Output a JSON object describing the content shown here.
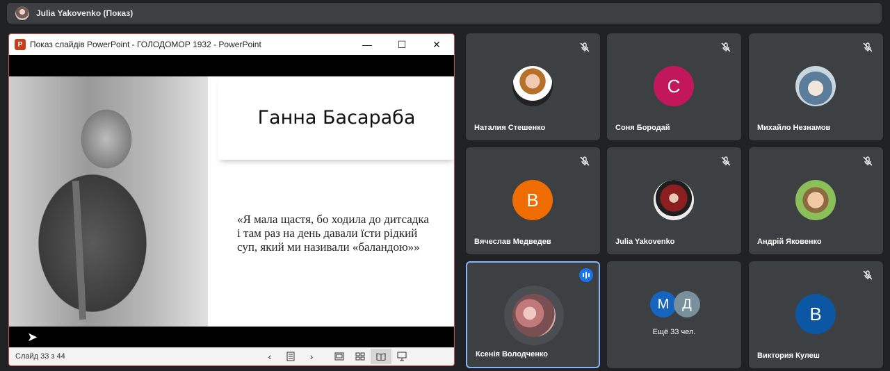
{
  "presenter": {
    "name": "Julia Yakovenko (Показ)"
  },
  "ppt": {
    "window_title": "Показ слайдів PowerPoint  -  ГОЛОДОМОР 1932 - PowerPoint",
    "logo_letter": "P",
    "slide_title": "Ганна Басараба",
    "quote": "«Я мала щастя, бо ходила до дитсадка і там раз на день давали їсти рідкий суп, який ми називали «баландою»»",
    "slide_counter": "Слайд 33 з 44",
    "minimize_glyph": "—",
    "maximize_glyph": "☐",
    "close_glyph": "✕",
    "prev_glyph": "‹",
    "next_glyph": "›"
  },
  "participants": [
    {
      "name": "Наталия Стешенко",
      "initial": "",
      "color": "#d9d9d9",
      "muted": true
    },
    {
      "name": "Соня Бородай",
      "initial": "С",
      "color": "#c2185b",
      "muted": true
    },
    {
      "name": "Михайло Незнамов",
      "initial": "",
      "color": "#6d8fa8",
      "muted": true
    },
    {
      "name": "Вячеслав Медведев",
      "initial": "В",
      "color": "#ef6c00",
      "muted": true
    },
    {
      "name": "Julia Yakovenko",
      "initial": "",
      "color": "#e9e2df",
      "muted": true
    },
    {
      "name": "Андрій Яковенко",
      "initial": "",
      "color": "#7aa35a",
      "muted": true
    },
    {
      "name": "Ксенія Володченко",
      "initial": "",
      "color": "#b07a78",
      "muted": false,
      "speaking": true
    },
    {
      "more_label": "Ещё 33 чел.",
      "initials": [
        "М",
        "Д"
      ],
      "colors": [
        "#1565c0",
        "#78909c"
      ]
    },
    {
      "name": "Виктория Кулеш",
      "initial": "В",
      "color": "#0b57a4",
      "muted": true
    }
  ]
}
